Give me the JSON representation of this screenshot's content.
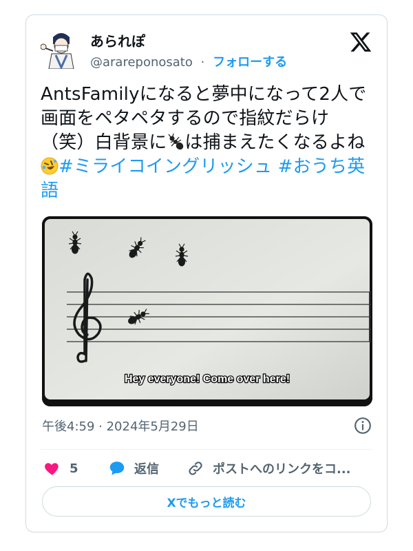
{
  "author": {
    "display_name": "あられぽ",
    "handle": "@arareponosato",
    "separator": "·",
    "follow_label": "フォローする"
  },
  "tweet": {
    "text_part1": "AntsFamilyになると夢中になって2人で画面をペタペタするので指紋だらけ（笑）白背景に",
    "text_part2": "は捕まえたくなるよね",
    "hashtag1": "#ミライコイングリッシュ",
    "hashtag2": "#おうち英語",
    "emoji_ant": "ant-emoji",
    "emoji_laugh": "rolling-on-floor-laughing-emoji"
  },
  "media": {
    "subtitle": "Hey everyone! Come over here!"
  },
  "timestamp": "午後4:59 · 2024年5月29日",
  "actions": {
    "like_count": "5",
    "reply_label": "返信",
    "link_label": "ポストへのリンクをコ..."
  },
  "read_more_label": "Xでもっと読む",
  "colors": {
    "accent": "#1d9bf0",
    "like": "#f91880",
    "text_primary": "#0f1419",
    "text_secondary": "#536471"
  }
}
